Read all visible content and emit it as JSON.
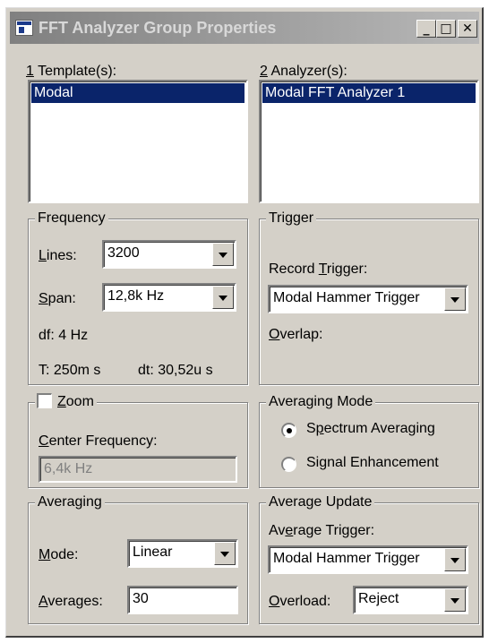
{
  "window": {
    "title": "FFT Analyzer Group Properties"
  },
  "titlebar": {
    "minimize": "_",
    "maximize": "□",
    "close": "✕"
  },
  "templates": {
    "label_key": "1",
    "label_rest": " Template(s):",
    "items": [
      "Modal"
    ]
  },
  "analyzers": {
    "label_key": "2",
    "label_rest": " Analyzer(s):",
    "items": [
      "Modal FFT Analyzer 1"
    ]
  },
  "frequency": {
    "title": "Frequency",
    "lines_key": "L",
    "lines_rest": "ines:",
    "lines_value": "3200",
    "span_key": "S",
    "span_rest": "pan:",
    "span_value": "12,8k Hz",
    "df": "df: 4 Hz",
    "t": "T: 250m s",
    "dt": "dt: 30,52u s"
  },
  "trigger": {
    "title": "Trigger",
    "record_pre": "Record ",
    "record_key": "T",
    "record_post": "rigger:",
    "record_value": "Modal Hammer Trigger",
    "overlap_pre": "O",
    "overlap_key": "v",
    "overlap_post": "erlap:"
  },
  "zoom": {
    "key": "Z",
    "rest": "oom",
    "checked": false,
    "center_key": "C",
    "center_rest": "enter Frequency:",
    "center_value": "6,4k Hz"
  },
  "averaging_mode": {
    "title": "Averaging Mode",
    "spectrum_pre": "S",
    "spectrum_key": "p",
    "spectrum_post": "ectrum Averaging",
    "signal_pre": "Si",
    "signal_key": "g",
    "signal_post": "nal Enhancement",
    "selected": "spectrum"
  },
  "averaging": {
    "title": "Averaging",
    "mode_key": "M",
    "mode_rest": "ode:",
    "mode_value": "Linear",
    "averages_key": "A",
    "averages_rest": "verages:",
    "averages_value": "30"
  },
  "average_update": {
    "title": "Average Update",
    "trigger_pre": "Av",
    "trigger_key": "e",
    "trigger_post": "rage Trigger:",
    "trigger_value": "Modal Hammer Trigger",
    "overload_key": "O",
    "overload_rest": "verload:",
    "overload_value": "Reject"
  }
}
